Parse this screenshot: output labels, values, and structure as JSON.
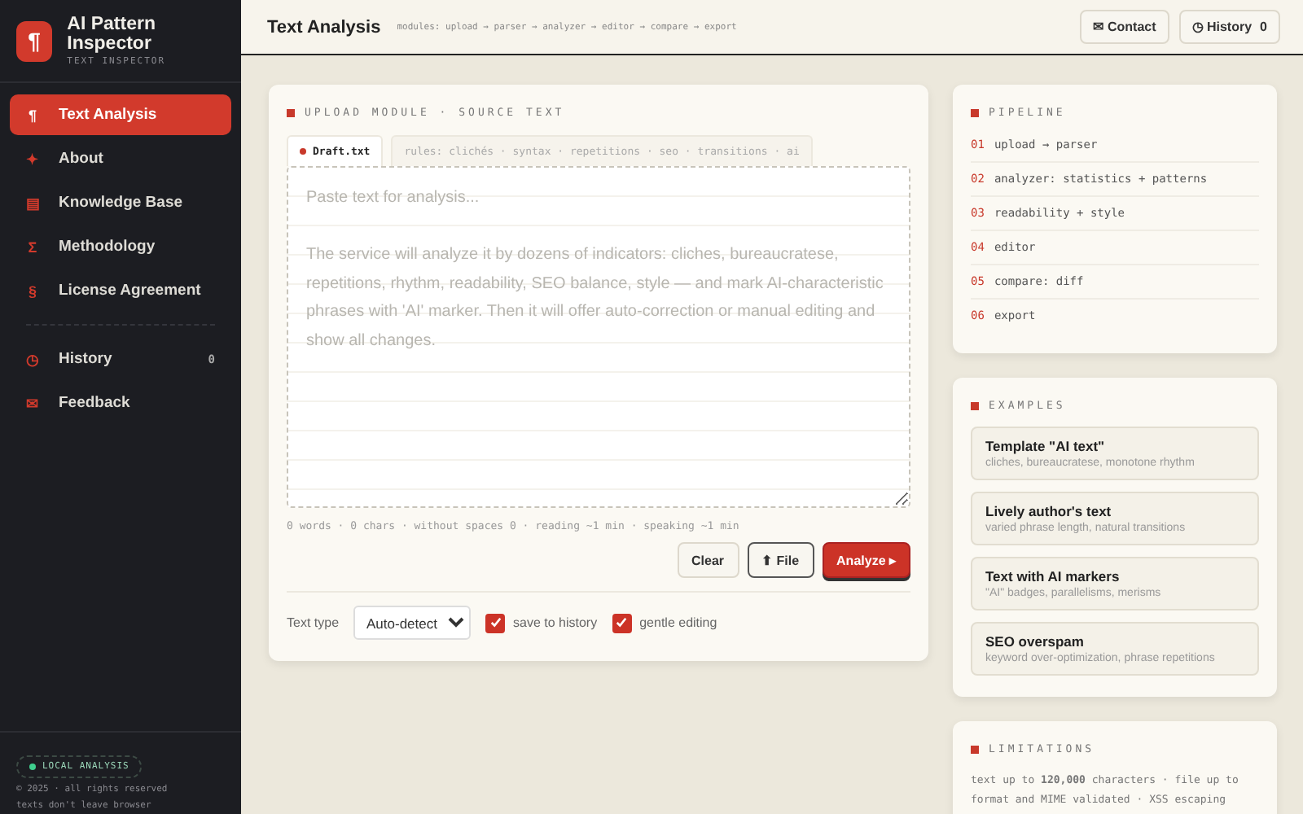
{
  "brand": {
    "logo": "¶",
    "title": "AI Pattern Inspector",
    "subtitle": "TEXT INSPECTOR"
  },
  "sidebar": {
    "items": [
      {
        "icon": "¶",
        "label": "Text Analysis",
        "selected": true
      },
      {
        "icon": "✦",
        "label": "About",
        "selected": false
      },
      {
        "icon": "▤",
        "label": "Knowledge Base",
        "selected": false
      },
      {
        "icon": "Σ",
        "label": "Methodology",
        "selected": false
      },
      {
        "icon": "§",
        "label": "License Agreement",
        "selected": false
      }
    ],
    "secondary_items": [
      {
        "icon": "◷",
        "label": "History",
        "count": "0",
        "selected": false
      },
      {
        "icon": "✉",
        "label": "Feedback",
        "selected": false
      }
    ],
    "footer": {
      "badge": "LOCAL ANALYSIS",
      "lines": [
        "© 2025 · all rights reserved",
        "texts don't leave browser"
      ]
    }
  },
  "header": {
    "title": "Text Analysis",
    "modules": "modules: upload → parser → analyzer → editor → compare → export",
    "buttons": [
      {
        "label": "✉ Contact"
      },
      {
        "label": "◷ History",
        "count": "0"
      }
    ]
  },
  "upload": {
    "title": "UPLOAD MODULE · SOURCE TEXT",
    "tabs": [
      {
        "label": "Draft.txt",
        "selected": true
      },
      {
        "label": "rules: clichés · syntax · repetitions · seo · transitions · ai",
        "selected": false
      }
    ],
    "placeholder": "Paste text for analysis...\n\nThe service will analyze it by dozens of indicators: cliches, bureaucratese, repetitions, rhythm, readability, SEO balance, style — and mark AI-characteristic phrases with 'AI' marker. Then it will offer auto-correction or manual editing and show all changes.",
    "stats": "0 words · 0 chars · without spaces 0 · reading ~1 min · speaking ~1 min",
    "buttons": [
      {
        "label": "Clear",
        "kind": "plain"
      },
      {
        "label": "⬆ File",
        "kind": "outlined"
      },
      {
        "label": "Analyze ▸",
        "kind": "primary"
      }
    ],
    "text_type": {
      "label": "Text type",
      "value": "Auto-detect"
    },
    "options": [
      {
        "label": "save to history",
        "checked": true
      },
      {
        "label": "gentle editing",
        "checked": true
      }
    ]
  },
  "pipeline": {
    "title": "PIPELINE",
    "steps": [
      {
        "num": "01",
        "text": "upload → parser"
      },
      {
        "num": "02",
        "text": "analyzer: statistics + patterns"
      },
      {
        "num": "03",
        "text": "readability + style"
      },
      {
        "num": "04",
        "text": "editor"
      },
      {
        "num": "05",
        "text": "compare: diff"
      },
      {
        "num": "06",
        "text": "export"
      }
    ]
  },
  "examples": {
    "title": "EXAMPLES",
    "items": [
      {
        "title": "Template \"AI text\"",
        "desc": "cliches, bureaucratese, monotone rhythm"
      },
      {
        "title": "Lively author's text",
        "desc": "varied phrase length, natural transitions"
      },
      {
        "title": "Text with AI markers",
        "desc": "\"AI\" badges, parallelisms, merisms"
      },
      {
        "title": "SEO overspam",
        "desc": "keyword over-optimization, phrase repetitions"
      }
    ]
  },
  "limitations": {
    "title": "LIMITATIONS",
    "text": "text up to **120,000** characters · file up to",
    "text_2": "format and MIME validated · XSS escaping"
  }
}
